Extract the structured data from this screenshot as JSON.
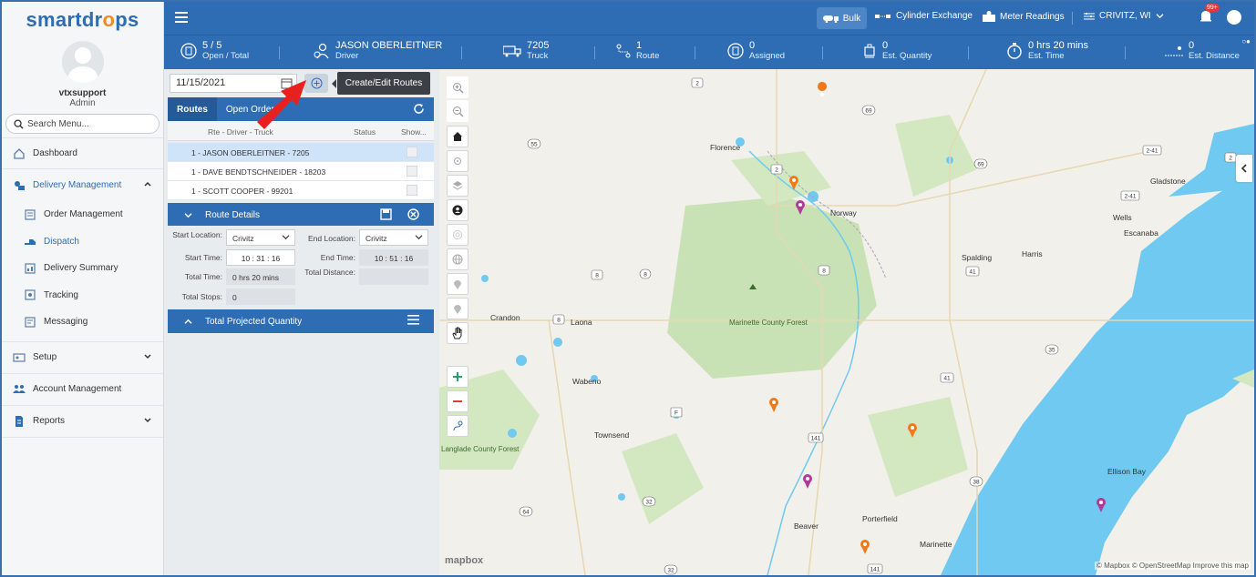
{
  "app": {
    "logo_pre": "smartdr",
    "logo_drop": "o",
    "logo_post": "ps"
  },
  "user": {
    "name": "vtxsupport",
    "role": "Admin"
  },
  "search": {
    "placeholder": "Search Menu..."
  },
  "menu": {
    "dashboard": "Dashboard",
    "delivery_management": "Delivery Management",
    "sub": [
      "Order Management",
      "Dispatch",
      "Delivery Summary",
      "Tracking",
      "Messaging"
    ],
    "setup": "Setup",
    "account_management": "Account Management",
    "reports": "Reports"
  },
  "topbar": {
    "bulk": "Bulk",
    "cylinder_exchange": "Cylinder Exchange",
    "meter_readings": "Meter Readings",
    "location": "CRIVITZ, WI",
    "notifications_badge": "99+"
  },
  "stats": {
    "open_total_value": "5 / 5",
    "open_total_label": "Open / Total",
    "driver_value": "JASON OBERLEITNER",
    "driver_label": "Driver",
    "truck_value": "7205",
    "truck_label": "Truck",
    "route_value": "1",
    "route_label": "Route",
    "assigned_value": "0",
    "assigned_label": "Assigned",
    "est_quantity_value": "0",
    "est_quantity_label": "Est. Quantity",
    "est_time_value": "0 hrs 20 mins",
    "est_time_label": "Est. Time",
    "est_distance_value": "0",
    "est_distance_label": "Est. Distance"
  },
  "panel": {
    "date": "11/15/2021",
    "tooltip": "Create/Edit Routes",
    "tabs": [
      "Routes",
      "Open Orders"
    ],
    "columns": {
      "rte": "Rte - Driver - Truck",
      "status": "Status",
      "show": "Show..."
    },
    "routes": [
      "1 - JASON OBERLEITNER - 7205",
      "1 - DAVE BENDTSCHNEIDER - 18203",
      "1 - SCOTT COOPER - 99201"
    ],
    "route_details_title": "Route Details",
    "start_location_label": "Start Location:",
    "start_location_value": "Crivitz",
    "end_location_label": "End Location:",
    "end_location_value": "Crivitz",
    "start_time_label": "Start Time:",
    "start_time_value": "10 : 31 : 16",
    "end_time_label": "End Time:",
    "end_time_value": "10 : 51 : 16",
    "total_time_label": "Total Time:",
    "total_time_value": "0 hrs 20 mins",
    "total_distance_label": "Total Distance:",
    "total_distance_value": "",
    "total_stops_label": "Total Stops:",
    "total_stops_value": "0",
    "tpq_title": "Total Projected Quantity"
  },
  "map": {
    "places": [
      "Florence",
      "Norway",
      "Gladstone",
      "Wells",
      "Escanaba",
      "Spalding",
      "Harris",
      "Crandon",
      "Laona",
      "Marinette County Forest",
      "Wabeno",
      "Townsend",
      "Langlade County Forest",
      "Ellison Bay",
      "Beaver",
      "Porterfield",
      "Marinette"
    ],
    "road_shields": [
      "2",
      "69",
      "55",
      "2",
      "69",
      "2-41",
      "2",
      "2-41",
      "8",
      "8",
      "8",
      "41",
      "8",
      "35",
      "41",
      "F",
      "141",
      "38",
      "32",
      "64",
      "141",
      "32"
    ],
    "attribution": "© Mapbox © OpenStreetMap  Improve this map",
    "brand": "mapbox",
    "colors": {
      "water": "#6fc9f0",
      "forest": "#c8e2b5",
      "land": "#f1f0ea",
      "pin_orange": "#f07a1a",
      "pin_purple": "#b0399a"
    }
  },
  "colors": {
    "primary": "#2e6db4",
    "accent": "#f08a24",
    "arrow": "#e8211e"
  }
}
